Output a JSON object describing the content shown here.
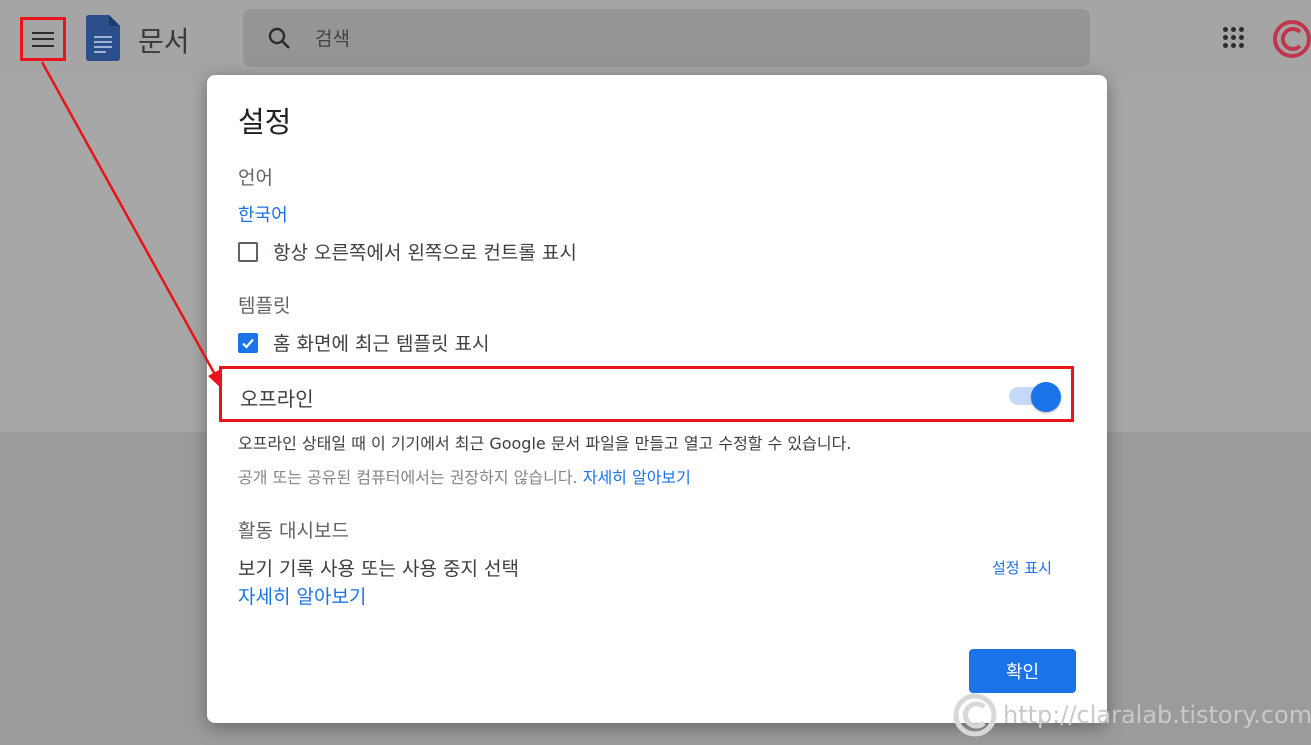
{
  "app": {
    "name": "문서"
  },
  "search": {
    "placeholder": "검색"
  },
  "settings_dialog": {
    "title": "설정",
    "language": {
      "label": "언어",
      "value": "한국어",
      "rtl_checkbox_label": "항상 오른쪽에서 왼쪽으로 컨트롤 표시",
      "rtl_checked": false
    },
    "templates": {
      "label": "템플릿",
      "checkbox_label": "홈 화면에 최근 템플릿 표시",
      "checked": true
    },
    "offline": {
      "label": "오프라인",
      "enabled": true,
      "description": "오프라인 상태일 때 이 기기에서 최근 Google 문서 파일을 만들고 열고 수정할 수 있습니다.",
      "warning": "공개 또는 공유된 컴퓨터에서는 권장하지 않습니다.",
      "learn_more": "자세히 알아보기"
    },
    "activity_dashboard": {
      "label": "활동 대시보드",
      "description": "보기 기록 사용 또는 사용 중지 선택",
      "show_settings": "설정 표시",
      "learn_more": "자세히 알아보기"
    },
    "confirm_label": "확인"
  },
  "watermark": {
    "text": "http://claralab.tistory.com"
  },
  "colors": {
    "accent": "#1a73e8",
    "annotation": "#e8141b"
  }
}
